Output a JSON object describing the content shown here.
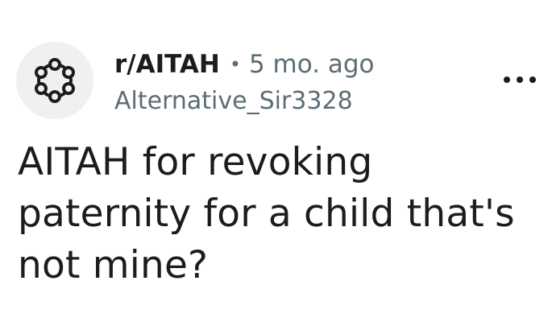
{
  "post": {
    "subreddit": "r/AITAH",
    "separator": "•",
    "time_ago": "5 mo. ago",
    "author": "Alternative_Sir3328",
    "title": "AITAH for revoking paternity for a child that's not mine?",
    "avatar_icon": "subreddit-ring-icon",
    "menu_icon": "more-options-icon"
  }
}
